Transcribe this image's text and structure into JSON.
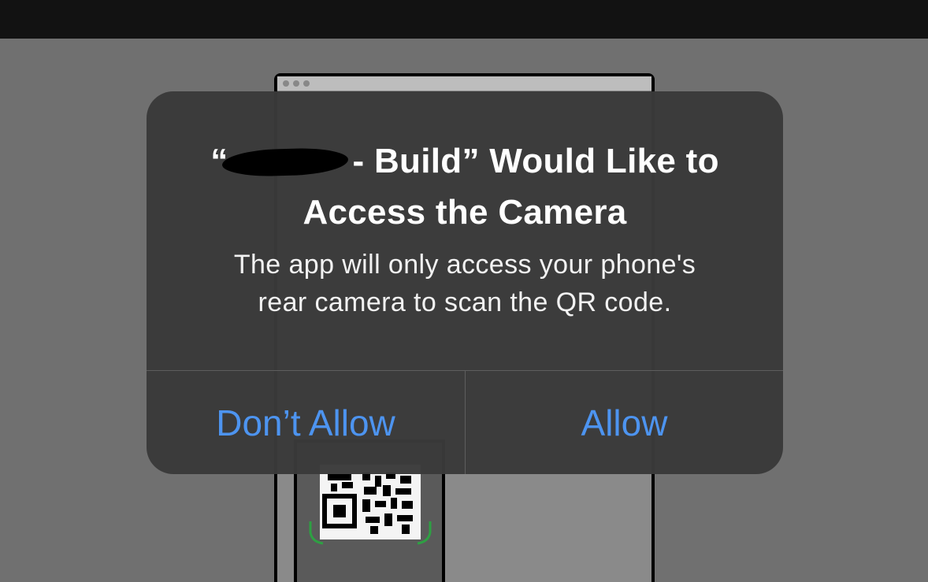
{
  "alert": {
    "title_open_quote": "“",
    "title_rest": "- Build” Would Like to",
    "title_line2": "Access the Camera",
    "message_line1": "The app will only access your phone's",
    "message_line2": "rear camera to scan the QR code.",
    "deny_label": "Don’t Allow",
    "allow_label": "Allow"
  },
  "colors": {
    "accent": "#4d94f0",
    "dialog_bg": "#3a3a3a",
    "scanner_corner": "#2ea043"
  }
}
